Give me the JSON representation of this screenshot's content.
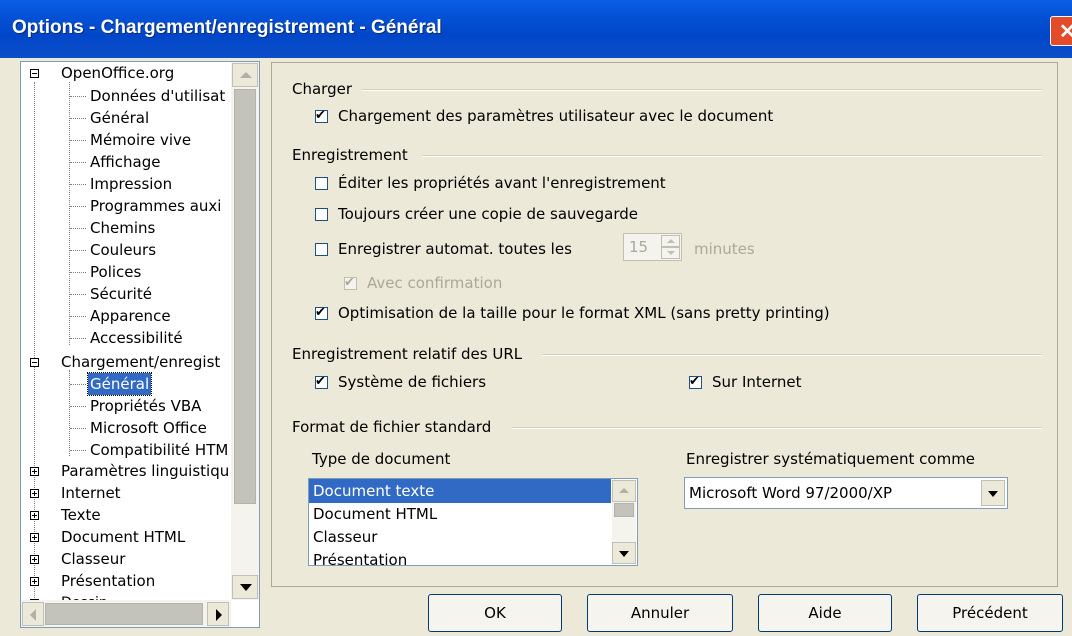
{
  "window": {
    "title": "Options - Chargement/enregistrement - Général"
  },
  "tree": {
    "items": [
      {
        "label": "OpenOffice.org"
      },
      {
        "label": "Données d'utilisat"
      },
      {
        "label": "Général"
      },
      {
        "label": "Mémoire vive"
      },
      {
        "label": "Affichage"
      },
      {
        "label": "Impression"
      },
      {
        "label": "Programmes auxi"
      },
      {
        "label": "Chemins"
      },
      {
        "label": "Couleurs"
      },
      {
        "label": "Polices"
      },
      {
        "label": "Sécurité"
      },
      {
        "label": "Apparence"
      },
      {
        "label": "Accessibilité"
      },
      {
        "label": "Chargement/enregist"
      },
      {
        "label": "Général"
      },
      {
        "label": "Propriétés VBA"
      },
      {
        "label": "Microsoft Office"
      },
      {
        "label": "Compatibilité HTM"
      },
      {
        "label": "Paramètres linguistiqu"
      },
      {
        "label": "Internet"
      },
      {
        "label": "Texte"
      },
      {
        "label": "Document HTML"
      },
      {
        "label": "Classeur"
      },
      {
        "label": "Présentation"
      },
      {
        "label": "Dessin"
      }
    ]
  },
  "charger": {
    "title": "Charger",
    "load_user_settings": {
      "label": "Chargement des paramètres utilisateur avec le document",
      "checked": true
    }
  },
  "enregistrement": {
    "title": "Enregistrement",
    "edit_props": {
      "label": "Éditer les propriétés avant l'enregistrement",
      "checked": false
    },
    "backup": {
      "label": "Toujours créer une copie de sauvegarde",
      "checked": false
    },
    "autosave": {
      "label": "Enregistrer automat. toutes les",
      "checked": false,
      "value": "15",
      "unit": "minutes"
    },
    "confirm": {
      "label": "Avec confirmation",
      "checked": true,
      "disabled": true
    },
    "xml_opt": {
      "label": "Optimisation de la taille pour le format XML (sans pretty printing)",
      "checked": true
    }
  },
  "url": {
    "title": "Enregistrement relatif des URL",
    "filesystem": {
      "label": "Système de fichiers",
      "checked": true
    },
    "internet": {
      "label": "Sur Internet",
      "checked": true
    }
  },
  "format": {
    "title": "Format de fichier standard",
    "doc_type_label": "Type de document",
    "doc_types": [
      "Document texte",
      "Document HTML",
      "Classeur",
      "Présentation"
    ],
    "selected_doc_type": "Document texte",
    "save_as_label": "Enregistrer systématiquement comme",
    "save_as_value": "Microsoft Word 97/2000/XP"
  },
  "buttons": {
    "ok": "OK",
    "cancel": "Annuler",
    "help": "Aide",
    "back": "Précédent"
  }
}
